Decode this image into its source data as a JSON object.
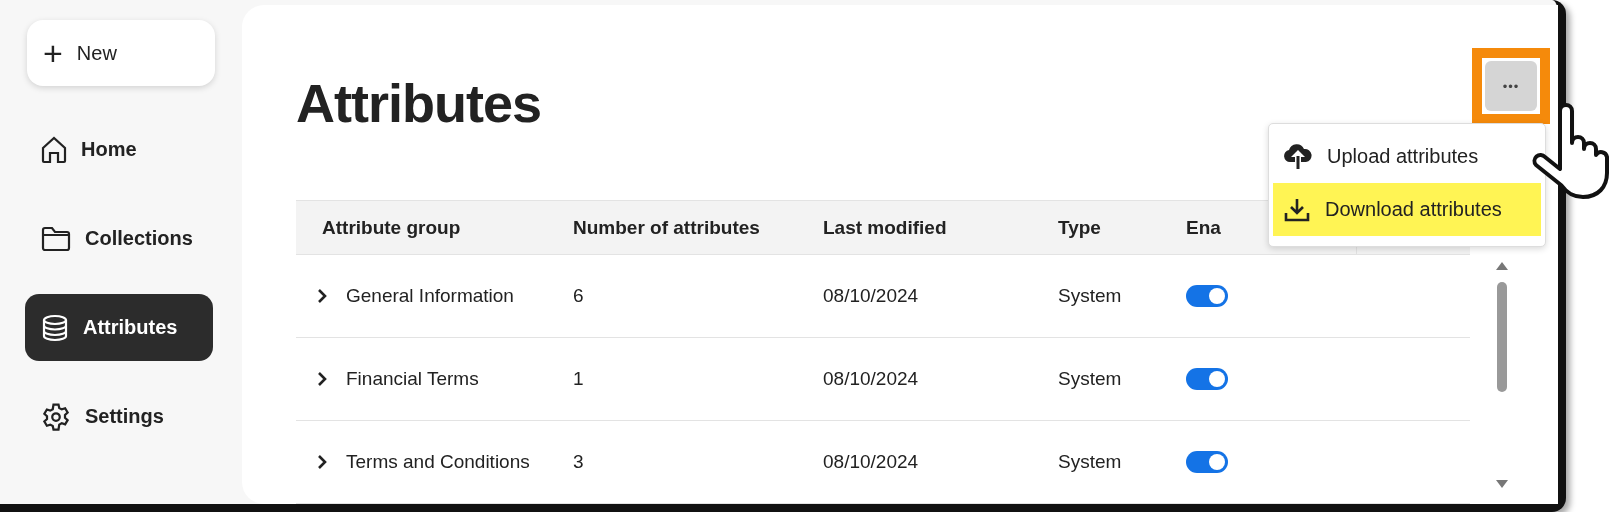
{
  "sidebar": {
    "new_button": {
      "icon": "+",
      "label": "New"
    },
    "items": [
      {
        "label": "Home",
        "kind": "home",
        "selected": false
      },
      {
        "label": "Collections",
        "kind": "folder",
        "selected": false
      },
      {
        "label": "Attributes",
        "kind": "database",
        "selected": true
      },
      {
        "label": "Settings",
        "kind": "gear",
        "selected": false
      }
    ]
  },
  "page_title": "Attributes",
  "more_button": {
    "label": "•••",
    "highlighted": true
  },
  "menu": {
    "items": [
      {
        "label": "Upload attributes",
        "kind": "upload",
        "highlighted": false
      },
      {
        "label": "Download attributes",
        "kind": "download",
        "highlighted": true
      }
    ]
  },
  "table": {
    "columns": [
      "Attribute group",
      "Number of attributes",
      "Last modified",
      "Type",
      "Ena"
    ],
    "rows": [
      {
        "name": "General Information",
        "count": "6",
        "modified": "08/10/2024",
        "type": "System",
        "enabled": true,
        "expanded": false
      },
      {
        "name": "Financial Terms",
        "count": "1",
        "modified": "08/10/2024",
        "type": "System",
        "enabled": true,
        "expanded": false
      },
      {
        "name": "Terms and Conditions",
        "count": "3",
        "modified": "08/10/2024",
        "type": "System",
        "enabled": true,
        "expanded": false
      }
    ]
  }
}
